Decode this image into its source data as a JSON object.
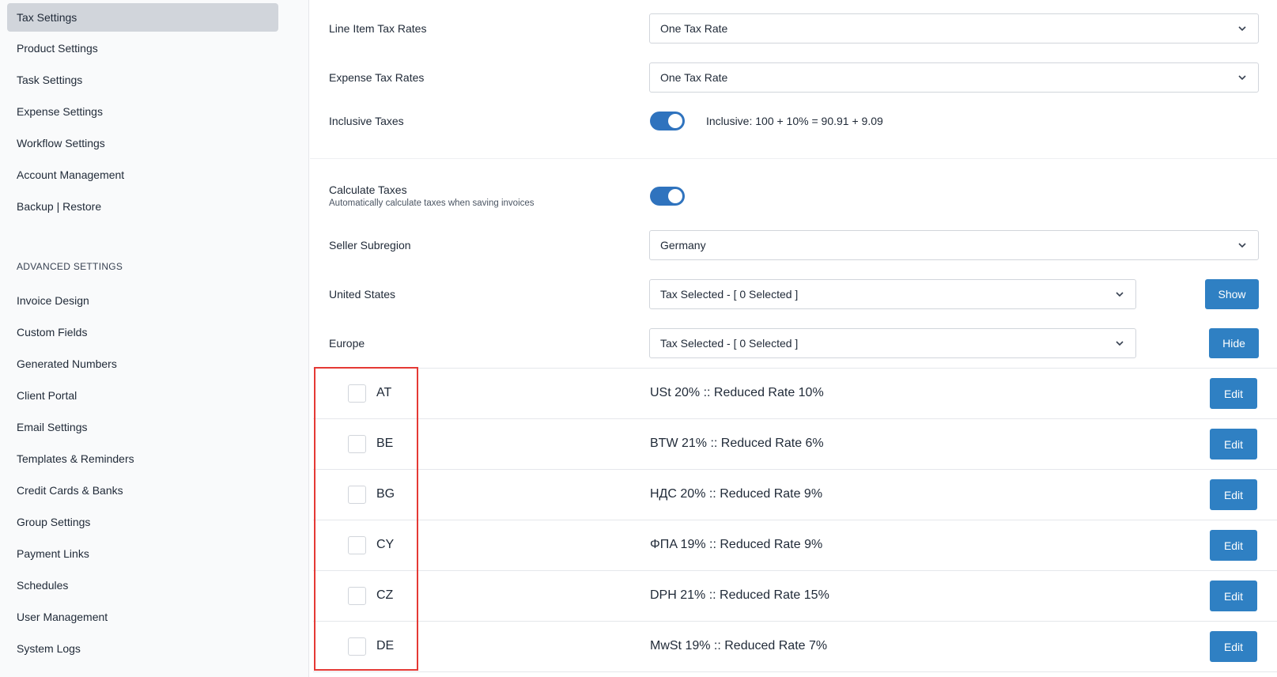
{
  "sidebar": {
    "items": [
      {
        "label": "Tax Settings",
        "active": true
      },
      {
        "label": "Product Settings"
      },
      {
        "label": "Task Settings"
      },
      {
        "label": "Expense Settings"
      },
      {
        "label": "Workflow Settings"
      },
      {
        "label": "Account Management"
      },
      {
        "label": "Backup | Restore"
      }
    ],
    "advanced_heading": "ADVANCED SETTINGS",
    "advanced_items": [
      {
        "label": "Invoice Design"
      },
      {
        "label": "Custom Fields"
      },
      {
        "label": "Generated Numbers"
      },
      {
        "label": "Client Portal"
      },
      {
        "label": "Email Settings"
      },
      {
        "label": "Templates & Reminders"
      },
      {
        "label": "Credit Cards & Banks"
      },
      {
        "label": "Group Settings"
      },
      {
        "label": "Payment Links"
      },
      {
        "label": "Schedules"
      },
      {
        "label": "User Management"
      },
      {
        "label": "System Logs"
      }
    ]
  },
  "form": {
    "line_item_tax_rates": {
      "label": "Line Item Tax Rates",
      "value": "One Tax Rate"
    },
    "expense_tax_rates": {
      "label": "Expense Tax Rates",
      "value": "One Tax Rate"
    },
    "inclusive_taxes": {
      "label": "Inclusive Taxes",
      "enabled": true,
      "hint": "Inclusive: 100 + 10% = 90.91 + 9.09"
    },
    "calculate_taxes": {
      "label": "Calculate Taxes",
      "description": "Automatically calculate taxes when saving invoices",
      "enabled": true
    },
    "seller_subregion": {
      "label": "Seller Subregion",
      "value": "Germany"
    },
    "united_states": {
      "label": "United States",
      "value": "Tax Selected - [ 0 Selected ]",
      "button": "Show"
    },
    "europe": {
      "label": "Europe",
      "value": "Tax Selected - [ 0 Selected ]",
      "button": "Hide"
    }
  },
  "eu_rates": [
    {
      "code": "AT",
      "rate": "USt 20% :: Reduced Rate 10%",
      "checked": false,
      "button": "Edit"
    },
    {
      "code": "BE",
      "rate": "BTW 21% :: Reduced Rate 6%",
      "checked": false,
      "button": "Edit"
    },
    {
      "code": "BG",
      "rate": "НДС 20% :: Reduced Rate 9%",
      "checked": false,
      "button": "Edit"
    },
    {
      "code": "CY",
      "rate": "ΦΠΑ 19% :: Reduced Rate 9%",
      "checked": false,
      "button": "Edit"
    },
    {
      "code": "CZ",
      "rate": "DPH 21% :: Reduced Rate 15%",
      "checked": false,
      "button": "Edit"
    },
    {
      "code": "DE",
      "rate": "MwSt 19% :: Reduced Rate 7%",
      "checked": false,
      "button": "Edit"
    }
  ],
  "colors": {
    "accent": "#2f80c3",
    "toggle_on": "#2f73be",
    "active_nav": "#d1d5db",
    "highlight": "#e53935"
  },
  "icons": {
    "dropdown": "chevron-down-icon"
  }
}
